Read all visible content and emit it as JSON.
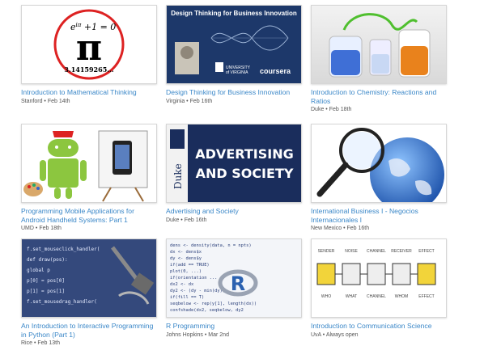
{
  "courses": [
    {
      "title": "Introduction to Mathematical Thinking",
      "school": "Stanford",
      "date": "Feb 14th",
      "thumb": {
        "equation": "e",
        "pi": "π",
        "digits": "3.14159265..."
      }
    },
    {
      "title": "Design Thinking for Business Innovation",
      "school": "Virginia",
      "date": "Feb 16th",
      "thumb": {
        "headline": "Design Thinking for Business Innovation",
        "univ": "UNIVERSITY of VIRGINIA",
        "brand": "coursera"
      }
    },
    {
      "title": "Introduction to Chemistry: Reactions and Ratios",
      "school": "Duke",
      "date": "Feb 18th"
    },
    {
      "title": "Programming Mobile Applications for Android Handheld Systems: Part 1",
      "school": "UMD",
      "date": "Feb 18th"
    },
    {
      "title": "Advertising and Society",
      "school": "Duke",
      "date": "Feb 16th",
      "thumb": {
        "line1": "ADVERTISING",
        "line2": "AND SOCIETY",
        "side": "Duke"
      }
    },
    {
      "title": "International Business I - Negocios Internacionales I",
      "school": "New Mexico",
      "date": "Feb 16th"
    },
    {
      "title": "An Introduction to Interactive Programming in Python (Part 1)",
      "school": "Rice",
      "date": "Feb 13th",
      "thumb": {
        "code": [
          "f.set_mouseclick_handler(",
          "def draw(pos):",
          "   global p",
          "   p[0] = pos[0]",
          "   p[1] = pos[1]",
          "f.set_mousedrag_handler("
        ]
      }
    },
    {
      "title": "R Programming",
      "school": "Johns Hopkins",
      "date": "Mar 2nd",
      "thumb": {
        "code": [
          "dens <- density(data, n = npts)",
          "  dx <- dens$x",
          "  dy <- dens$y",
          "  if(add == TRUE)",
          "    plot(0, ...)",
          "  if(orientation ...",
          "    dx2 <- dx",
          "    dy2 <- (dy - min(dy))",
          "  if(fill == T)",
          "    seqbelow <- rep(y[1], length(dx))",
          "    confshade(dx2, seqbelow, dy2"
        ],
        "logo": "R"
      }
    },
    {
      "title": "Introduction to Communication Science",
      "school": "UvA",
      "date": "Always open",
      "thumb": {
        "labels": [
          "SENDER",
          "NOISE",
          "CHANNEL",
          "RECEIVER",
          "EFFECT"
        ],
        "bottom": [
          "WHO",
          "WHAT",
          "CHANNEL",
          "WHOM",
          "EFFECT"
        ]
      }
    }
  ],
  "sep": "•"
}
